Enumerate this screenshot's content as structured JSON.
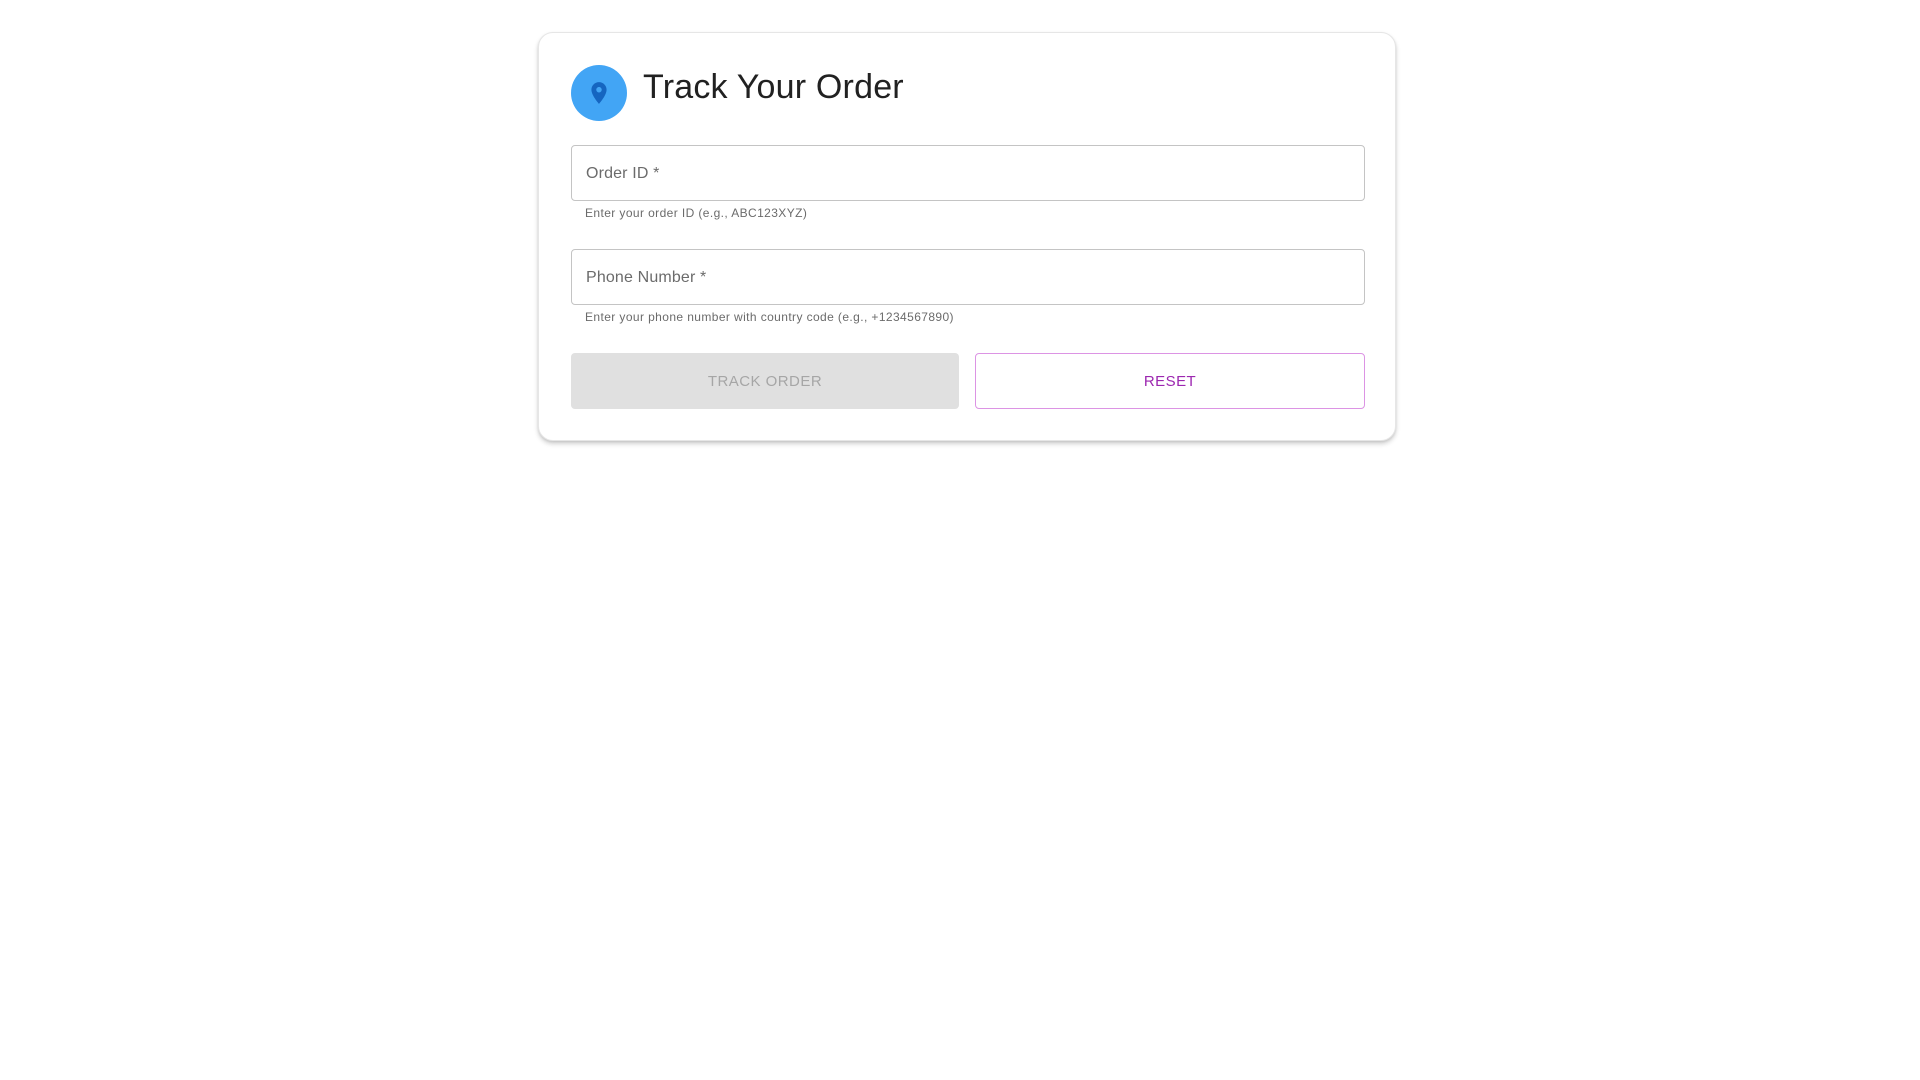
{
  "header": {
    "title": "Track Your Order",
    "icon": "location-pin-icon",
    "icon_bg_color": "#42a5f5",
    "icon_color": "#1565c0"
  },
  "form": {
    "order_id": {
      "label": "Order ID *",
      "value": "",
      "helper": "Enter your order ID (e.g., ABC123XYZ)"
    },
    "phone": {
      "label": "Phone Number *",
      "value": "",
      "helper": "Enter your phone number with country code (e.g., +1234567890)"
    }
  },
  "actions": {
    "track_label": "Track Order",
    "track_disabled": true,
    "reset_label": "Reset",
    "reset_color": "#9c27b0"
  }
}
